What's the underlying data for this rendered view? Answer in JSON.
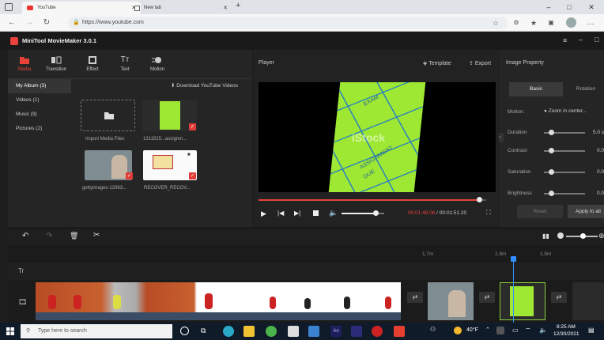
{
  "browser": {
    "tabs": [
      {
        "label": "YouTube",
        "active": true
      },
      {
        "label": "New tab",
        "active": false
      }
    ],
    "url": "https://www.youtube.com"
  },
  "app": {
    "title": "MiniTool MovieMaker 3.0.1",
    "media_tabs": [
      {
        "label": "Media",
        "icon": "folder-icon",
        "active": true
      },
      {
        "label": "Transition",
        "icon": "transition-icon",
        "active": false
      },
      {
        "label": "Effect",
        "icon": "effect-icon",
        "active": false
      },
      {
        "label": "Text",
        "icon": "text-icon",
        "active": false
      },
      {
        "label": "Motion",
        "icon": "motion-icon",
        "active": false
      }
    ],
    "sidebar": [
      {
        "label": "My Album (3)",
        "active": true
      },
      {
        "label": "Videos (1)",
        "active": false
      },
      {
        "label": "Music (9)",
        "active": false
      },
      {
        "label": "Pictures (2)",
        "active": false
      }
    ],
    "download_label": "Download YouTube Videos",
    "media_items": [
      {
        "caption": "Import Media Files"
      },
      {
        "caption": "1311525...assignm..."
      },
      {
        "caption": "gettyimages-12983..."
      },
      {
        "caption": "RECOVER_RECOV..."
      }
    ],
    "player": {
      "title": "Player",
      "template_label": "Template",
      "export_label": "Export",
      "watermark": "iStock",
      "current_time": "00:01:48.06",
      "separator": "/",
      "total_time": "00:01:51.20",
      "progress": 0.97,
      "volume": 0.8
    },
    "image_property": {
      "title": "Image Property",
      "tabs": [
        "Basic",
        "Rotation"
      ],
      "motion_label": "Motion:",
      "motion_value": "Zoom in center...",
      "rows": [
        {
          "label": "Duration",
          "value": "5.0 s"
        },
        {
          "label": "Contrast",
          "value": "0.0"
        },
        {
          "label": "Saturation",
          "value": "0.0"
        },
        {
          "label": "Brightness",
          "value": "0.0"
        }
      ],
      "reset_label": "Reset",
      "apply_label": "Apply to all"
    },
    "timeline": {
      "ruler": [
        "1.7m",
        "1.8m",
        "1.9m"
      ],
      "text_track_label": "Tr"
    }
  },
  "taskbar": {
    "search_placeholder": "Type here to search",
    "weather": "40°F",
    "time": "8:25 AM",
    "date": "12/30/2021"
  },
  "colors": {
    "accent": "#e8423a",
    "playhead": "#2f8fff",
    "paper": "#9ee833"
  }
}
